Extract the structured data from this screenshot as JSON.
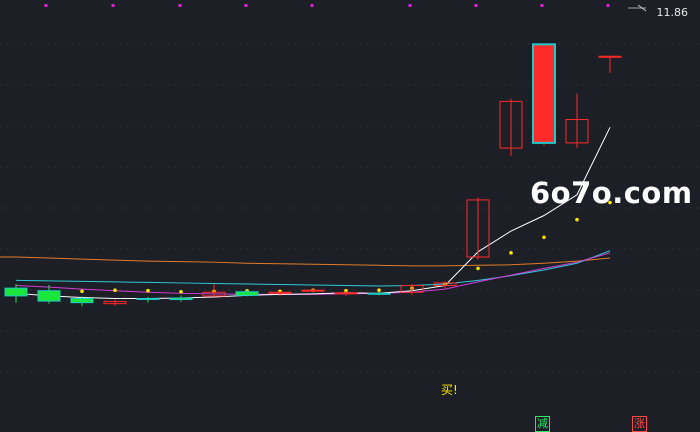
{
  "price_label": "11.86",
  "watermark": "6o7o.com",
  "buy_signal": "买!",
  "badge_decrease": "减",
  "badge_increase": "涨",
  "colors": {
    "background": "#1c1f26",
    "grid": "#3a3f4a",
    "up": "#ff2a2a",
    "down": "#19e83a",
    "down_border": "#20c8c8",
    "ma_short": "#ffffff",
    "ma_cyan": "#2ec8d8",
    "ma_magenta": "#d23cd8",
    "ma_orange": "#e07b2a",
    "dots": "#ffe600",
    "markers": "#e01ee0"
  },
  "chart_data": {
    "type": "candlestick",
    "title": "",
    "price_label": 11.86,
    "candles": [
      {
        "o": 6.5,
        "c": 6.35,
        "h": 6.58,
        "l": 6.22,
        "dir": "down"
      },
      {
        "o": 6.45,
        "c": 6.25,
        "h": 6.56,
        "l": 6.2,
        "dir": "down"
      },
      {
        "o": 6.3,
        "c": 6.22,
        "h": 6.34,
        "l": 6.15,
        "dir": "down"
      },
      {
        "o": 6.2,
        "c": 6.24,
        "h": 6.28,
        "l": 6.16,
        "dir": "up"
      },
      {
        "o": 6.3,
        "c": 6.29,
        "h": 6.33,
        "l": 6.22,
        "dir": "down"
      },
      {
        "o": 6.31,
        "c": 6.28,
        "h": 6.36,
        "l": 6.24,
        "dir": "down"
      },
      {
        "o": 6.35,
        "c": 6.42,
        "h": 6.58,
        "l": 6.33,
        "dir": "up"
      },
      {
        "o": 6.43,
        "c": 6.36,
        "h": 6.48,
        "l": 6.34,
        "dir": "down"
      },
      {
        "o": 6.4,
        "c": 6.42,
        "h": 6.44,
        "l": 6.34,
        "dir": "up"
      },
      {
        "o": 6.45,
        "c": 6.46,
        "h": 6.5,
        "l": 6.42,
        "dir": "up"
      },
      {
        "o": 6.4,
        "c": 6.41,
        "h": 6.44,
        "l": 6.35,
        "dir": "up"
      },
      {
        "o": 6.4,
        "c": 6.39,
        "h": 6.43,
        "l": 6.36,
        "dir": "down"
      },
      {
        "o": 6.42,
        "c": 6.55,
        "h": 6.58,
        "l": 6.37,
        "dir": "up"
      },
      {
        "o": 6.55,
        "c": 6.6,
        "h": 6.63,
        "l": 6.5,
        "dir": "up"
      },
      {
        "o": 7.1,
        "c": 8.2,
        "h": 8.25,
        "l": 7.05,
        "dir": "up"
      },
      {
        "o": 9.2,
        "c": 10.1,
        "h": 10.15,
        "l": 9.05,
        "dir": "up"
      },
      {
        "o": 9.3,
        "c": 11.2,
        "h": 11.2,
        "l": 9.25,
        "dir": "up"
      },
      {
        "o": 9.3,
        "c": 9.75,
        "h": 10.25,
        "l": 9.2,
        "dir": "up"
      },
      {
        "o": 10.95,
        "c": 10.97,
        "h": 10.98,
        "l": 10.65,
        "dir": "up"
      }
    ],
    "ma_short": [
      6.4,
      6.35,
      6.32,
      6.3,
      6.3,
      6.31,
      6.33,
      6.36,
      6.38,
      6.39,
      6.41,
      6.4,
      6.45,
      6.55,
      7.2,
      7.6,
      7.9,
      8.3,
      9.6
    ],
    "ma_cyan": [
      6.65,
      6.64,
      6.63,
      6.62,
      6.61,
      6.6,
      6.59,
      6.58,
      6.57,
      6.56,
      6.55,
      6.54,
      6.55,
      6.58,
      6.65,
      6.74,
      6.85,
      6.98,
      7.22
    ],
    "ma_magenta": [
      6.55,
      6.52,
      6.48,
      6.45,
      6.42,
      6.4,
      6.39,
      6.38,
      6.38,
      6.38,
      6.39,
      6.4,
      6.42,
      6.48,
      6.62,
      6.75,
      6.88,
      7.0,
      7.18
    ],
    "ma_orange": [
      7.1,
      7.08,
      7.06,
      7.04,
      7.02,
      7.01,
      7.0,
      6.98,
      6.97,
      6.96,
      6.95,
      6.94,
      6.93,
      6.93,
      6.94,
      6.95,
      6.98,
      7.02,
      7.08
    ],
    "dots": [
      6.38,
      6.42,
      6.44,
      6.46,
      6.45,
      6.43,
      6.44,
      6.45,
      6.44,
      6.46,
      6.45,
      6.46,
      6.5,
      6.58,
      6.88,
      7.18,
      7.48,
      7.82,
      8.15
    ],
    "ylim": [
      5.5,
      11.9
    ]
  }
}
